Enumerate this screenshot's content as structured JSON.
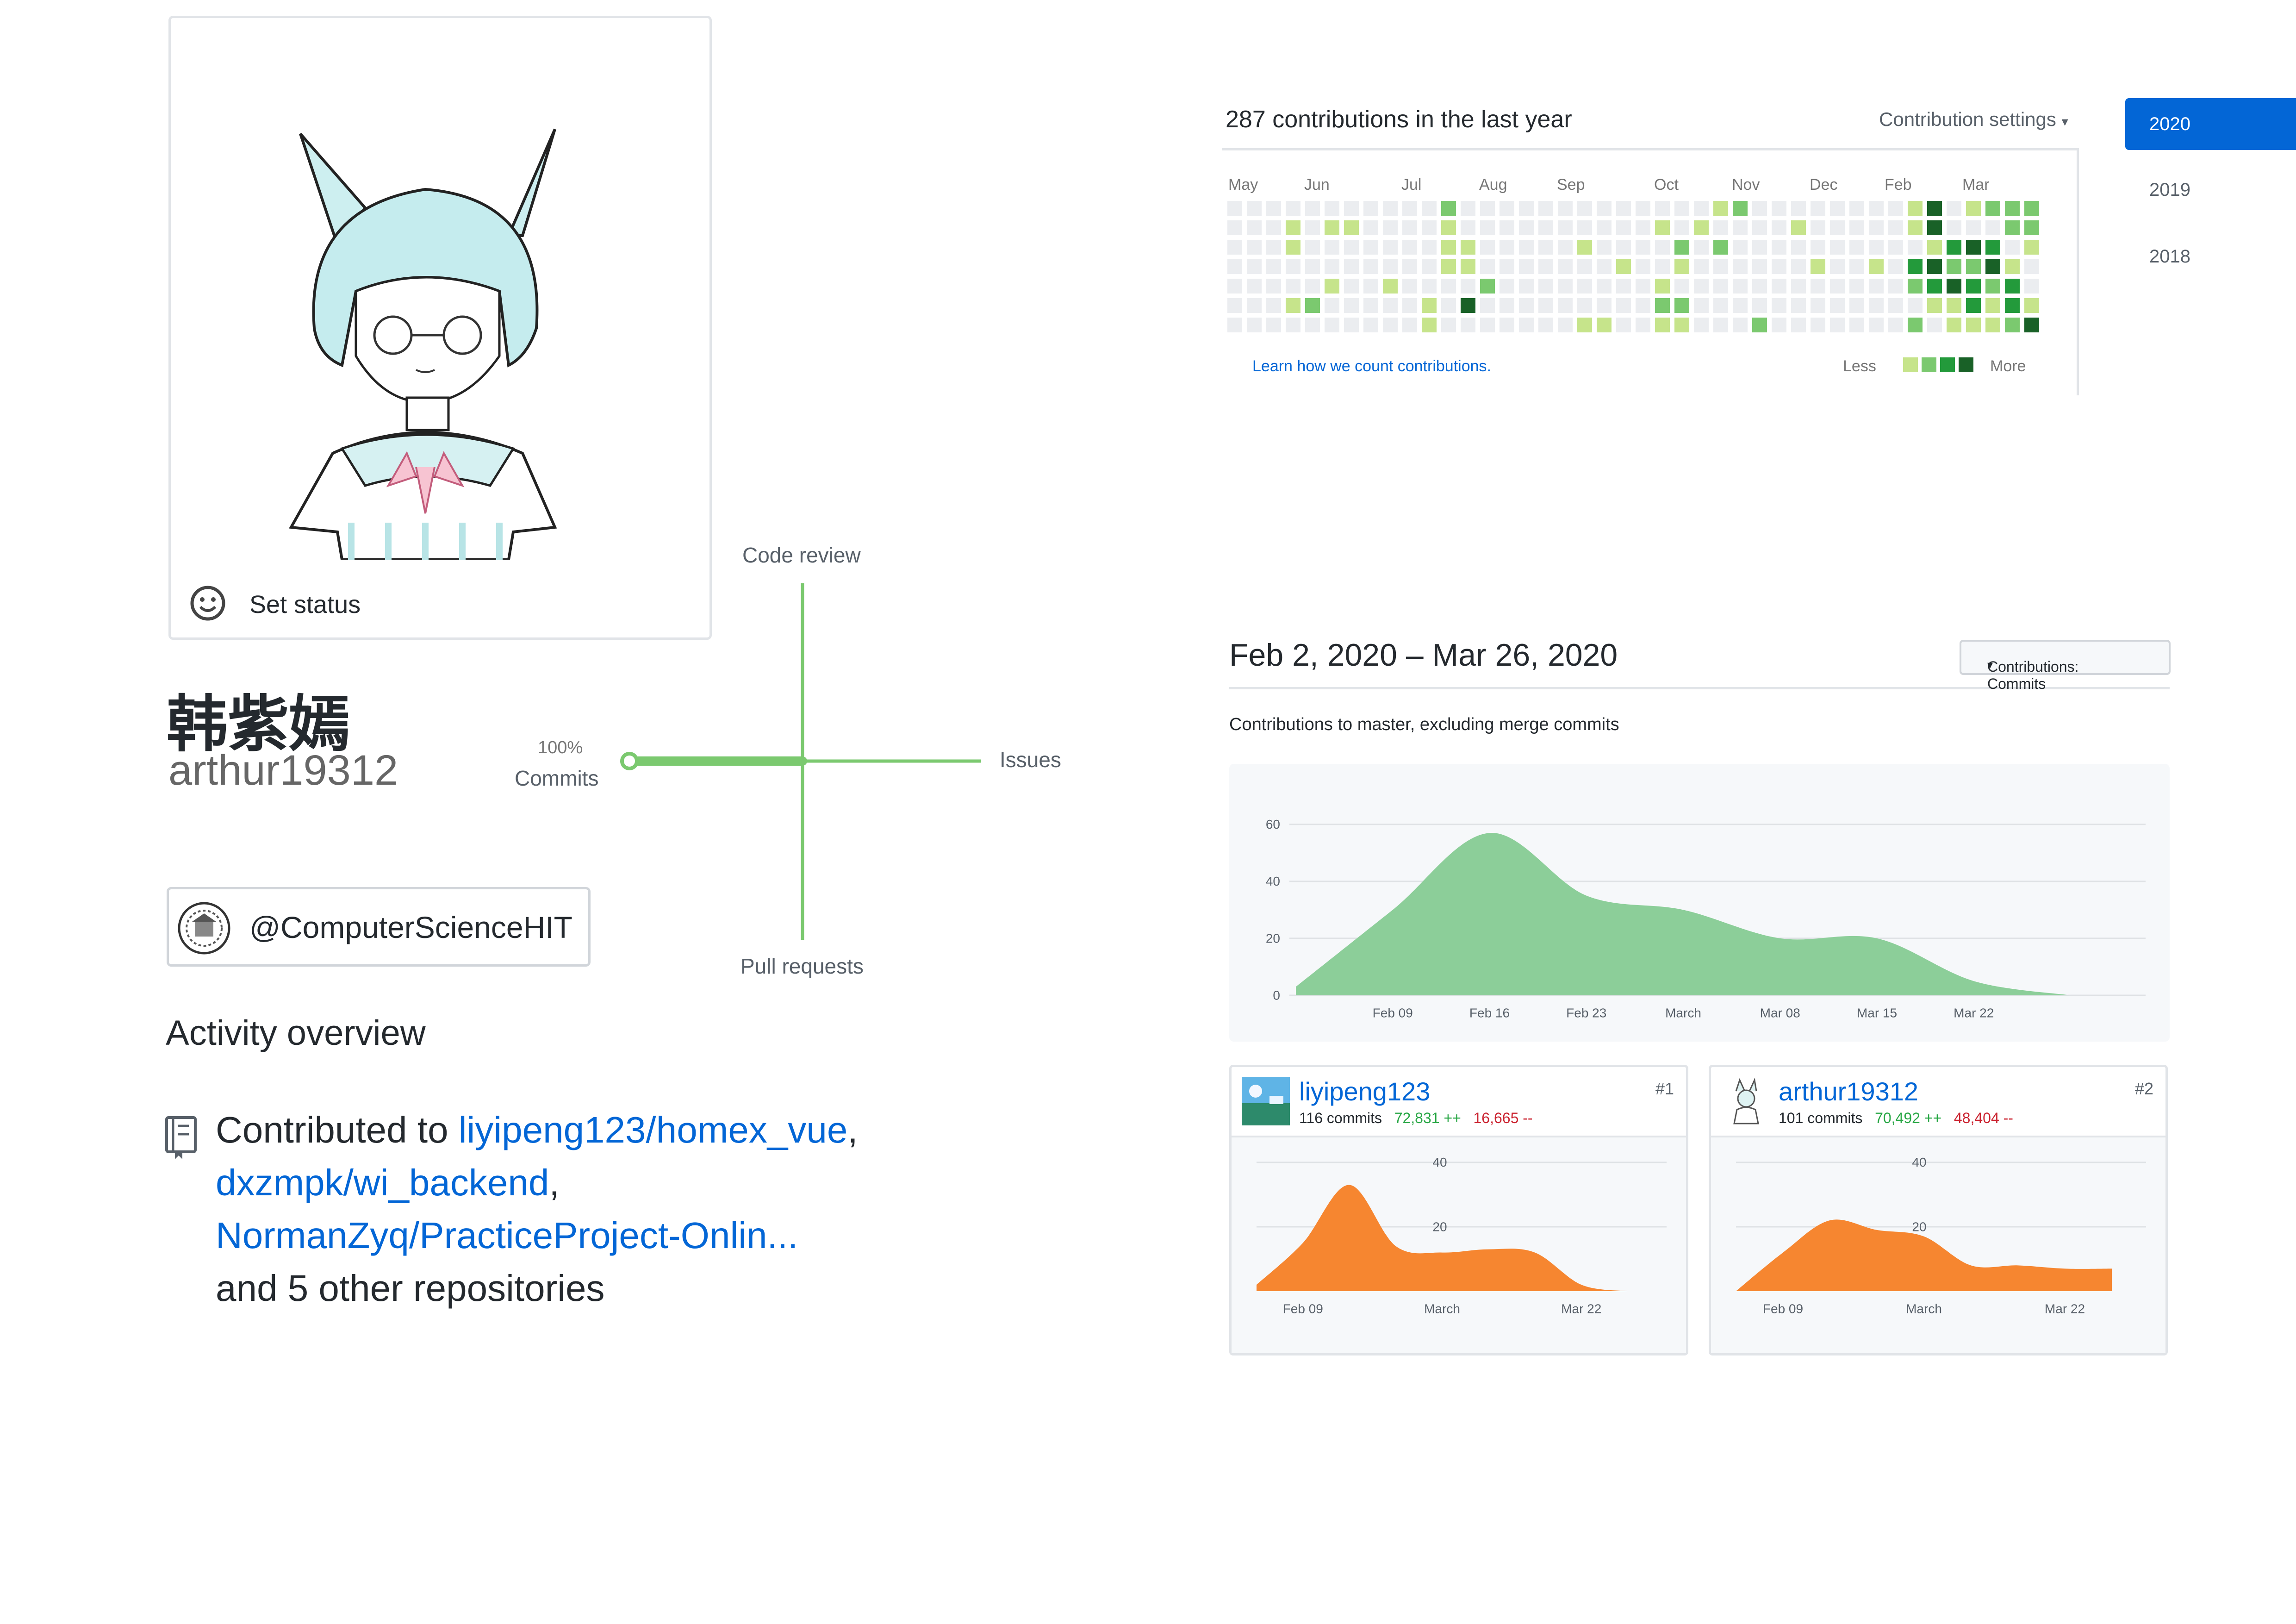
{
  "profile": {
    "set_status_label": "Set status",
    "real_name": "韩紫嫣",
    "login": "arthur19312",
    "organization": "@ComputerScienceHIT"
  },
  "activity": {
    "title": "Activity overview",
    "contributed_prefix": "Contributed to ",
    "repos": [
      "liyipeng123/homex_vue",
      "dxzmpk/wi_backend",
      "NormanZyq/PracticeProject-Onlin..."
    ],
    "other_repos": "and 5 other repositories",
    "axes": {
      "code_review": "Code review",
      "issues": "Issues",
      "pull_requests": "Pull requests",
      "commits_pct": "100%",
      "commits": "Commits"
    },
    "commits_share": 1.0
  },
  "calendar": {
    "heading": "287 contributions in the last year",
    "settings_label": "Contribution settings",
    "months": [
      "May",
      "Jun",
      "Jul",
      "Aug",
      "Sep",
      "Oct",
      "Nov",
      "Dec",
      "Feb",
      "Mar"
    ],
    "learn_link": "Learn how we count contributions.",
    "less": "Less",
    "more": "More",
    "colors": [
      "#ebedf0",
      "#c6e48b",
      "#7bc96f",
      "#239a3b",
      "#196127"
    ]
  },
  "years": [
    "2020",
    "2019",
    "2018"
  ],
  "range": {
    "title": "Feb 2, 2020 – Mar 26, 2020",
    "select_label": "Contributions: Commits",
    "subtitle": "Contributions to master, excluding merge commits"
  },
  "chart_data": [
    {
      "type": "area",
      "title": "",
      "x": [
        "Feb 02",
        "Feb 09",
        "Feb 16",
        "Feb 23",
        "Mar 01",
        "Mar 08",
        "Mar 15",
        "Mar 22",
        "Mar 26"
      ],
      "x_tick_labels": [
        "Feb 09",
        "Feb 16",
        "Feb 23",
        "March",
        "Mar 08",
        "Mar 15",
        "Mar 22"
      ],
      "series": [
        {
          "values": [
            3,
            30,
            57,
            35,
            30,
            20,
            20,
            5,
            0
          ]
        }
      ],
      "y_ticks": [
        0,
        20,
        40,
        60
      ],
      "ylim": [
        0,
        65
      ],
      "color": "#8cce99"
    },
    {
      "type": "area",
      "title": "",
      "x": [
        "Feb 02",
        "Feb 09",
        "Feb 16",
        "Feb 23",
        "Mar 01",
        "Mar 08",
        "Mar 15",
        "Mar 22",
        "Mar 26"
      ],
      "x_tick_labels": [
        "Feb 09",
        "March",
        "Mar 22"
      ],
      "series": [
        {
          "values": [
            2,
            15,
            33,
            14,
            12,
            13,
            12,
            2,
            0
          ]
        }
      ],
      "y_ticks": [
        20,
        40
      ],
      "ylim": [
        0,
        42
      ],
      "color": "#f68630"
    },
    {
      "type": "area",
      "title": "",
      "x": [
        "Feb 02",
        "Feb 09",
        "Feb 16",
        "Feb 23",
        "Mar 01",
        "Mar 08",
        "Mar 15",
        "Mar 22",
        "Mar 26"
      ],
      "x_tick_labels": [
        "Feb 09",
        "March",
        "Mar 22"
      ],
      "series": [
        {
          "values": [
            0,
            12,
            22,
            19,
            17,
            8,
            8,
            7,
            7
          ]
        }
      ],
      "y_ticks": [
        20,
        40
      ],
      "ylim": [
        0,
        42
      ],
      "color": "#f68630"
    }
  ],
  "contributors": [
    {
      "name": "liyipeng123",
      "commits": "116 commits",
      "additions": "72,831 ++",
      "deletions": "16,665 --",
      "rank": "#1"
    },
    {
      "name": "arthur19312",
      "commits": "101 commits",
      "additions": "70,492 ++",
      "deletions": "48,404 --",
      "rank": "#2"
    }
  ]
}
